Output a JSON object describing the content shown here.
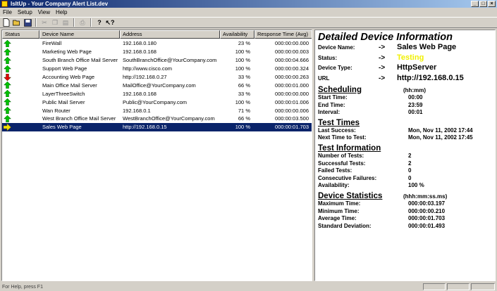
{
  "app": {
    "title": "IsItUp - Your Company Alert List.dev"
  },
  "window_controls": {
    "minimize": "_",
    "maximize": "□",
    "close": "×"
  },
  "menu": [
    "File",
    "Setup",
    "View",
    "Help"
  ],
  "toolbar_icons": [
    "new-icon",
    "open-icon",
    "save-icon",
    "cut-icon",
    "copy-icon",
    "paste-icon",
    "print-icon",
    "help-icon",
    "context-help-icon"
  ],
  "columns": [
    "Status",
    "Device Name",
    "Address",
    "Availability",
    "Response Time (Avg)"
  ],
  "rows": [
    {
      "status": "up",
      "name": "FireWall",
      "address": "192.168.0.180",
      "availability": "23 %",
      "response": "000:00:00.000"
    },
    {
      "status": "up",
      "name": "Marketing Web Page",
      "address": "192.168.0.168",
      "availability": "100 %",
      "response": "000:00:00.003"
    },
    {
      "status": "up",
      "name": "South Branch Office Mail Server",
      "address": "SouthBranchOffice@YourCompany.com",
      "availability": "100 %",
      "response": "000:00:04.666"
    },
    {
      "status": "up",
      "name": "Support Web Page",
      "address": "http://www.cisco.com",
      "availability": "100 %",
      "response": "000:00:00.324"
    },
    {
      "status": "down",
      "name": "Accounting Web Page",
      "address": "http://192.168.0.27",
      "availability": "33 %",
      "response": "000:00:00.263"
    },
    {
      "status": "up",
      "name": "Main Office Mail Server",
      "address": "MailOffice@YourCompany.com",
      "availability": "66 %",
      "response": "000:00:01.000"
    },
    {
      "status": "up",
      "name": "LayerThreeSwitch",
      "address": "192.168.0.168",
      "availability": "33 %",
      "response": "000:00:00.000"
    },
    {
      "status": "up",
      "name": "Public Mail Server",
      "address": "Public@YourCompany.com",
      "availability": "100 %",
      "response": "000:00:01.006"
    },
    {
      "status": "up",
      "name": "Wan Router",
      "address": "192.168.0.1",
      "availability": "71 %",
      "response": "000:00:00.006"
    },
    {
      "status": "up",
      "name": "West Branch Office Mail Server",
      "address": "WestBranchOffice@YourCompany.com",
      "availability": "66 %",
      "response": "000:00:03.500"
    },
    {
      "status": "testing",
      "name": "Sales Web Page",
      "address": "http://192.168.0.15",
      "availability": "100 %",
      "response": "000:00:01.703"
    }
  ],
  "selected_row": 10,
  "detail": {
    "title": "Detailed Device Information",
    "device": [
      {
        "label": "Device Name:",
        "arrow": "->",
        "value": "Sales Web Page",
        "color": "#000000"
      },
      {
        "label": "Status:",
        "arrow": "->",
        "value": "Testing",
        "color": "#f0f000"
      },
      {
        "label": "Device Type:",
        "arrow": "->",
        "value": "HttpServer",
        "color": "#000000"
      },
      {
        "label": "URL",
        "arrow": "->",
        "value": "http://192.168.0.15",
        "color": "#000000"
      }
    ],
    "scheduling": {
      "heading": "Scheduling",
      "unit": "(hh:mm)",
      "items": [
        {
          "label": "Start Time:",
          "value": "00:00"
        },
        {
          "label": "End Time:",
          "value": "23:59"
        },
        {
          "label": "Interval:",
          "value": "00:01"
        }
      ]
    },
    "test_times": {
      "heading": "Test Times",
      "unit": "",
      "items": [
        {
          "label": "Last Success:",
          "value": "Mon, Nov 11, 2002 17:44"
        },
        {
          "label": "Next Time to Test:",
          "value": "Mon, Nov 11, 2002 17:45"
        }
      ]
    },
    "test_info": {
      "heading": "Test Information",
      "unit": "",
      "items": [
        {
          "label": "Number of Tests:",
          "value": "2"
        },
        {
          "label": "Successful Tests:",
          "value": "2"
        },
        {
          "label": "Failed Tests:",
          "value": "0"
        },
        {
          "label": "Consecutive Failures:",
          "value": "0"
        },
        {
          "label": "Availability:",
          "value": "100 %"
        }
      ]
    },
    "stats": {
      "heading": "Device Statistics",
      "unit": "(hhh:mm:ss.ms)",
      "items": [
        {
          "label": "Maximum Time:",
          "value": "000:00:03.197"
        },
        {
          "label": "Minimum Time:",
          "value": "000:00:00.210"
        },
        {
          "label": "Average Time:",
          "value": "000:00:01.703"
        },
        {
          "label": "Standard Deviation:",
          "value": "000:00:01.493"
        }
      ]
    }
  },
  "statusbar": {
    "text": "For Help, press F1"
  },
  "colors": {
    "up": "#00c000",
    "down": "#e00000",
    "testing": "#f0e000",
    "selection": "#0a246a",
    "titlebar": "#0a246a"
  }
}
